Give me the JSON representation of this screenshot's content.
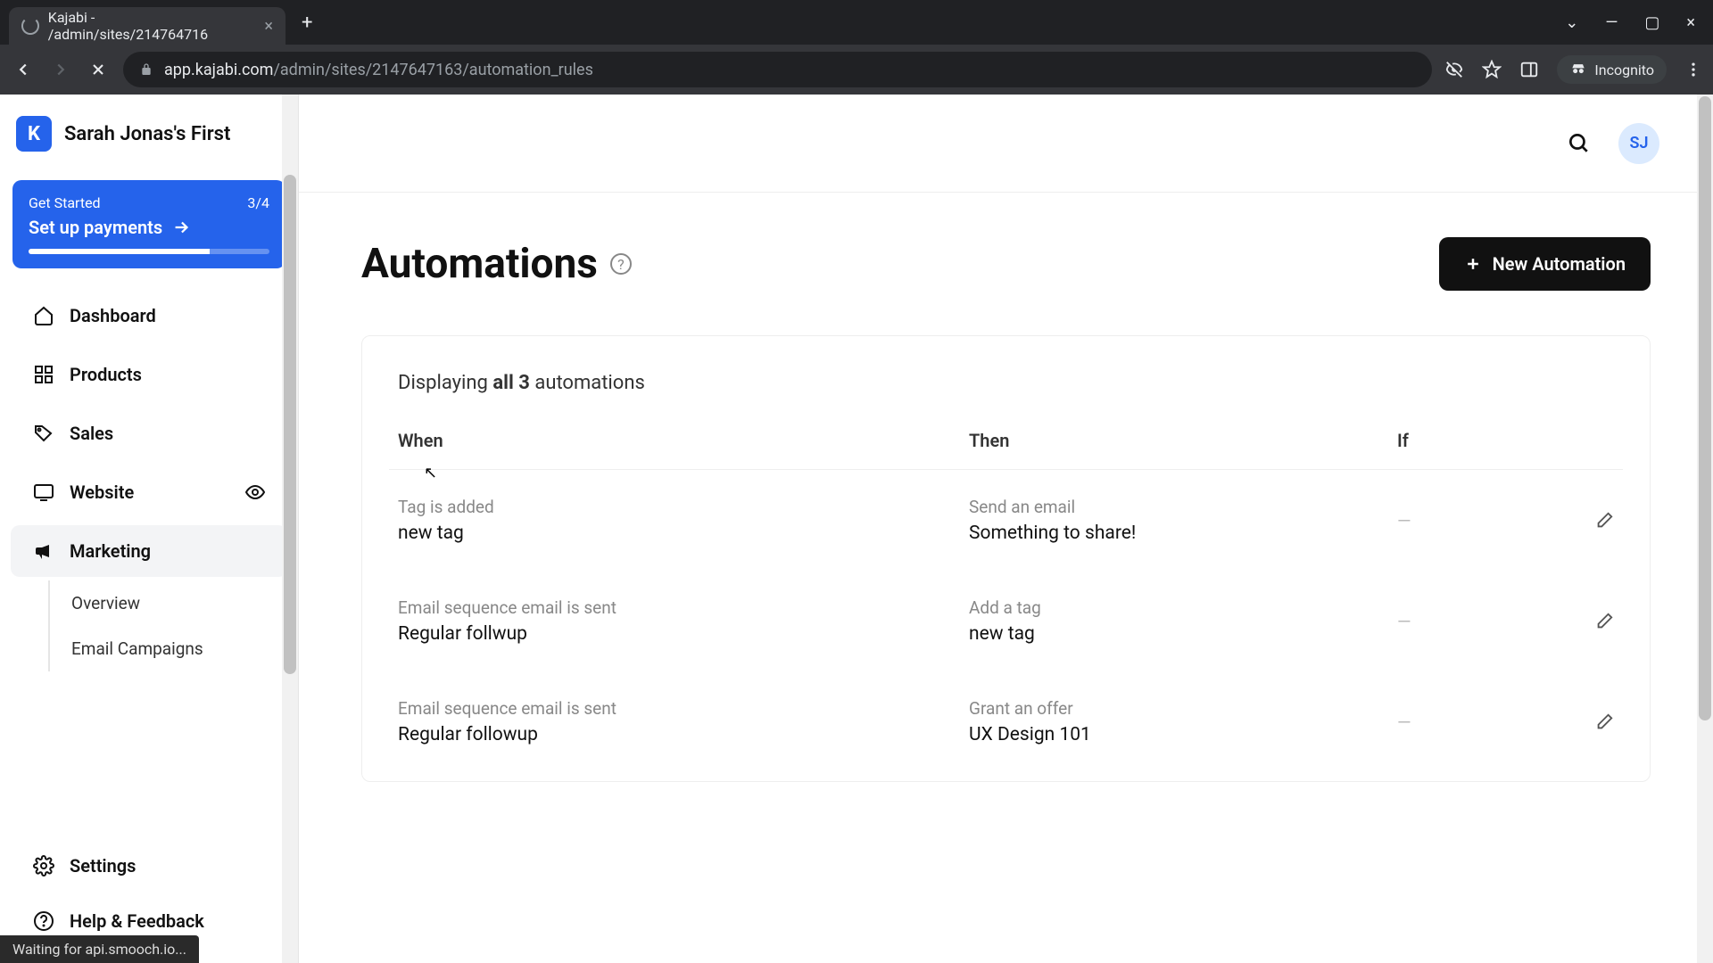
{
  "browser": {
    "tab_title": "Kajabi - /admin/sites/214764716",
    "url_secure_domain": "app.kajabi.com",
    "url_path": "/admin/sites/2147647163/automation_rules",
    "incognito_label": "Incognito",
    "status_text": "Waiting for api.smooch.io..."
  },
  "brand": {
    "logo_letter": "K",
    "site_name": "Sarah Jonas's First"
  },
  "get_started": {
    "label": "Get Started",
    "progress_text": "3/4",
    "cta": "Set up payments"
  },
  "nav": {
    "dashboard": "Dashboard",
    "products": "Products",
    "sales": "Sales",
    "website": "Website",
    "marketing": "Marketing",
    "settings": "Settings",
    "help": "Help & Feedback"
  },
  "subnav": {
    "overview": "Overview",
    "email_campaigns": "Email Campaigns"
  },
  "topbar": {
    "avatar_initials": "SJ"
  },
  "page": {
    "title": "Automations",
    "new_button": "New Automation",
    "displaying_prefix": "Displaying ",
    "displaying_count": "all 3",
    "displaying_suffix": " automations"
  },
  "table": {
    "headers": {
      "when": "When",
      "then": "Then",
      "if": "If"
    },
    "rows": [
      {
        "when_type": "Tag is added",
        "when_val": "new tag",
        "then_type": "Send an email",
        "then_val": "Something to share!",
        "if": "—"
      },
      {
        "when_type": "Email sequence email is sent",
        "when_val": "Regular follwup",
        "then_type": "Add a tag",
        "then_val": "new tag",
        "if": "—"
      },
      {
        "when_type": "Email sequence email is sent",
        "when_val": "Regular followup",
        "then_type": "Grant an offer",
        "then_val": "UX Design 101",
        "if": "—"
      }
    ]
  }
}
